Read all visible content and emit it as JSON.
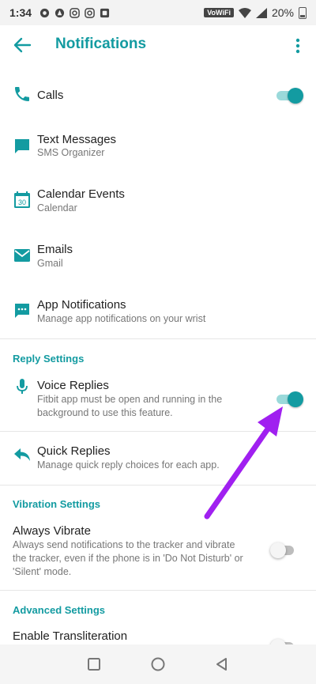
{
  "status": {
    "time": "1:34",
    "network": "VoWiFi",
    "battery": "20%"
  },
  "appbar": {
    "title": "Notifications"
  },
  "rows": {
    "calls": {
      "title": "Calls",
      "toggle": "on"
    },
    "text_messages": {
      "title": "Text Messages",
      "subtitle": "SMS Organizer"
    },
    "calendar_events": {
      "title": "Calendar Events",
      "subtitle": "Calendar",
      "icon_number": "30"
    },
    "emails": {
      "title": "Emails",
      "subtitle": "Gmail"
    },
    "app_notifications": {
      "title": "App Notifications",
      "subtitle": "Manage app notifications on your wrist"
    }
  },
  "reply_settings": {
    "header": "Reply Settings",
    "voice_replies": {
      "title": "Voice Replies",
      "subtitle_line1": "Fitbit app must be open and running in the",
      "subtitle_line2": "background to use this feature.",
      "toggle": "on"
    },
    "quick_replies": {
      "title": "Quick Replies",
      "subtitle": "Manage quick reply choices for each app."
    }
  },
  "vibration_settings": {
    "header": "Vibration Settings",
    "always_vibrate": {
      "title": "Always Vibrate",
      "subtitle_line1": "Always send notifications to the tracker and vibrate",
      "subtitle_line2": "the tracker, even if the phone is in 'Do Not Disturb' or",
      "subtitle_line3": "'Silent' mode.",
      "toggle": "off"
    }
  },
  "advanced_settings": {
    "header": "Advanced Settings",
    "enable_transliteration": {
      "title": "Enable Transliteration",
      "toggle": "off"
    }
  },
  "colors": {
    "accent": "#139ba1",
    "annotation_arrow": "#a020f0"
  },
  "icons": {
    "back": "arrow-left-icon",
    "overflow": "more-vert-icon",
    "calls": "phone-icon",
    "text_messages": "chat-bubble-icon",
    "calendar": "calendar-icon",
    "emails": "mail-icon",
    "app_notifications": "dotted-bubble-icon",
    "voice_replies": "microphone-icon",
    "quick_replies": "reply-icon"
  }
}
